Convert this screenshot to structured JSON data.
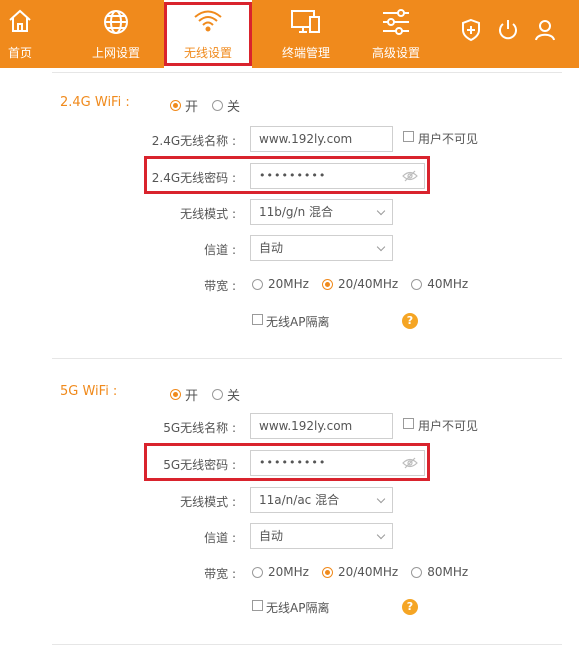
{
  "nav": {
    "items": [
      {
        "label": "首页",
        "icon": "home-icon"
      },
      {
        "label": "上网设置",
        "icon": "globe-icon"
      },
      {
        "label": "无线设置",
        "icon": "wifi-icon"
      },
      {
        "label": "终端管理",
        "icon": "devices-icon"
      },
      {
        "label": "高级设置",
        "icon": "sliders-icon"
      }
    ],
    "active_index": 2,
    "right_icons": [
      "shield-plus-icon",
      "power-icon",
      "user-icon"
    ]
  },
  "wifi24": {
    "title": "2.4G WiFi :",
    "switch": {
      "on_label": "开",
      "off_label": "关",
      "selected": "on"
    },
    "ssid_label": "2.4G无线名称 :",
    "ssid_value": "www.192ly.com",
    "hide_ssid_label": "用户不可见",
    "password_label": "2.4G无线密码 :",
    "password_value": "•••••••••",
    "mode_label": "无线模式 :",
    "mode_value": "11b/g/n 混合",
    "channel_label": "信道 :",
    "channel_value": "自动",
    "bandwidth_label": "带宽 :",
    "bandwidth_options": [
      "20MHz",
      "20/40MHz",
      "40MHz"
    ],
    "bandwidth_selected": "20/40MHz",
    "ap_isolation_label": "无线AP隔离",
    "help": "?"
  },
  "wifi5": {
    "title": "5G WiFi :",
    "switch": {
      "on_label": "开",
      "off_label": "关",
      "selected": "on"
    },
    "ssid_label": "5G无线名称 :",
    "ssid_value": "www.192ly.com",
    "hide_ssid_label": "用户不可见",
    "password_label": "5G无线密码 :",
    "password_value": "•••••••••",
    "mode_label": "无线模式 :",
    "mode_value": "11a/n/ac 混合",
    "channel_label": "信道 :",
    "channel_value": "自动",
    "bandwidth_label": "带宽 :",
    "bandwidth_options": [
      "20MHz",
      "20/40MHz",
      "80MHz"
    ],
    "bandwidth_selected": "20/40MHz",
    "ap_isolation_label": "无线AP隔离",
    "help": "?"
  },
  "colors": {
    "brand": "#f08a1c",
    "highlight": "#d9232d",
    "help": "#f5a524"
  }
}
